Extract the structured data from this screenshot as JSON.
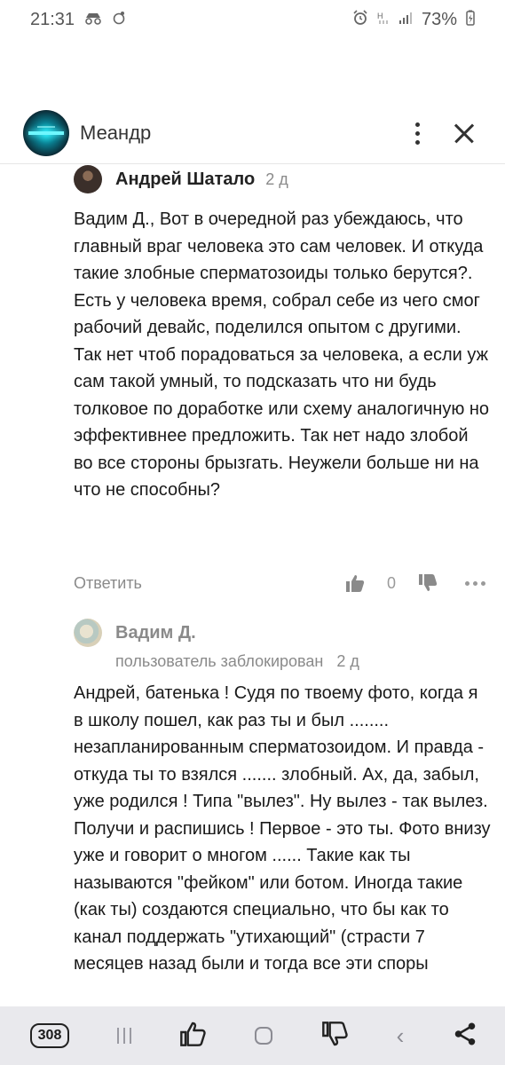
{
  "status_bar": {
    "time": "21:31",
    "battery": "73%"
  },
  "header": {
    "channel_name": "Меандр"
  },
  "comments": [
    {
      "author": "Андрей Шатало",
      "time": "2 д",
      "text": "Вадим Д., Вот в очередной раз убеждаюсь, что главный враг человека это сам человек. И откуда такие злобные сперматозоиды только берутся?. Есть у человека время, собрал себе из чего смог рабочий девайс, поделился опытом с другими. Так нет чтоб порадоваться за человека, а если уж сам такой умный, то подсказать что ни будь толковое по доработке или схему аналогичную но эффективнее предложить. Так нет надо злобой во все стороны брызгать. Неужели больше ни на что не способны?",
      "reply_label": "Ответить",
      "likes": "0"
    },
    {
      "author": "Вадим Д.",
      "status": "пользователь заблокирован",
      "time": "2 д",
      "text": "Андрей, батенька ! Судя по твоему фото, когда я в школу пошел, как раз ты и был ........ незапланированным сперматозоидом. И правда - откуда ты то взялся ....... злобный. Ах, да, забыл, уже родился ! Типа \"вылез\". Ну вылез - так вылез. Получи и распишись ! Первое - это ты. Фото внизу уже и говорит о многом ...... Такие как ты называются \"фейком\" или ботом. Иногда такие (как ты) создаются специально, что бы как то канал поддержать \"утихающий\" (страсти 7 месяцев назад были и тогда все эти споры"
    }
  ],
  "bottom_bar": {
    "tabs_count": "308"
  }
}
